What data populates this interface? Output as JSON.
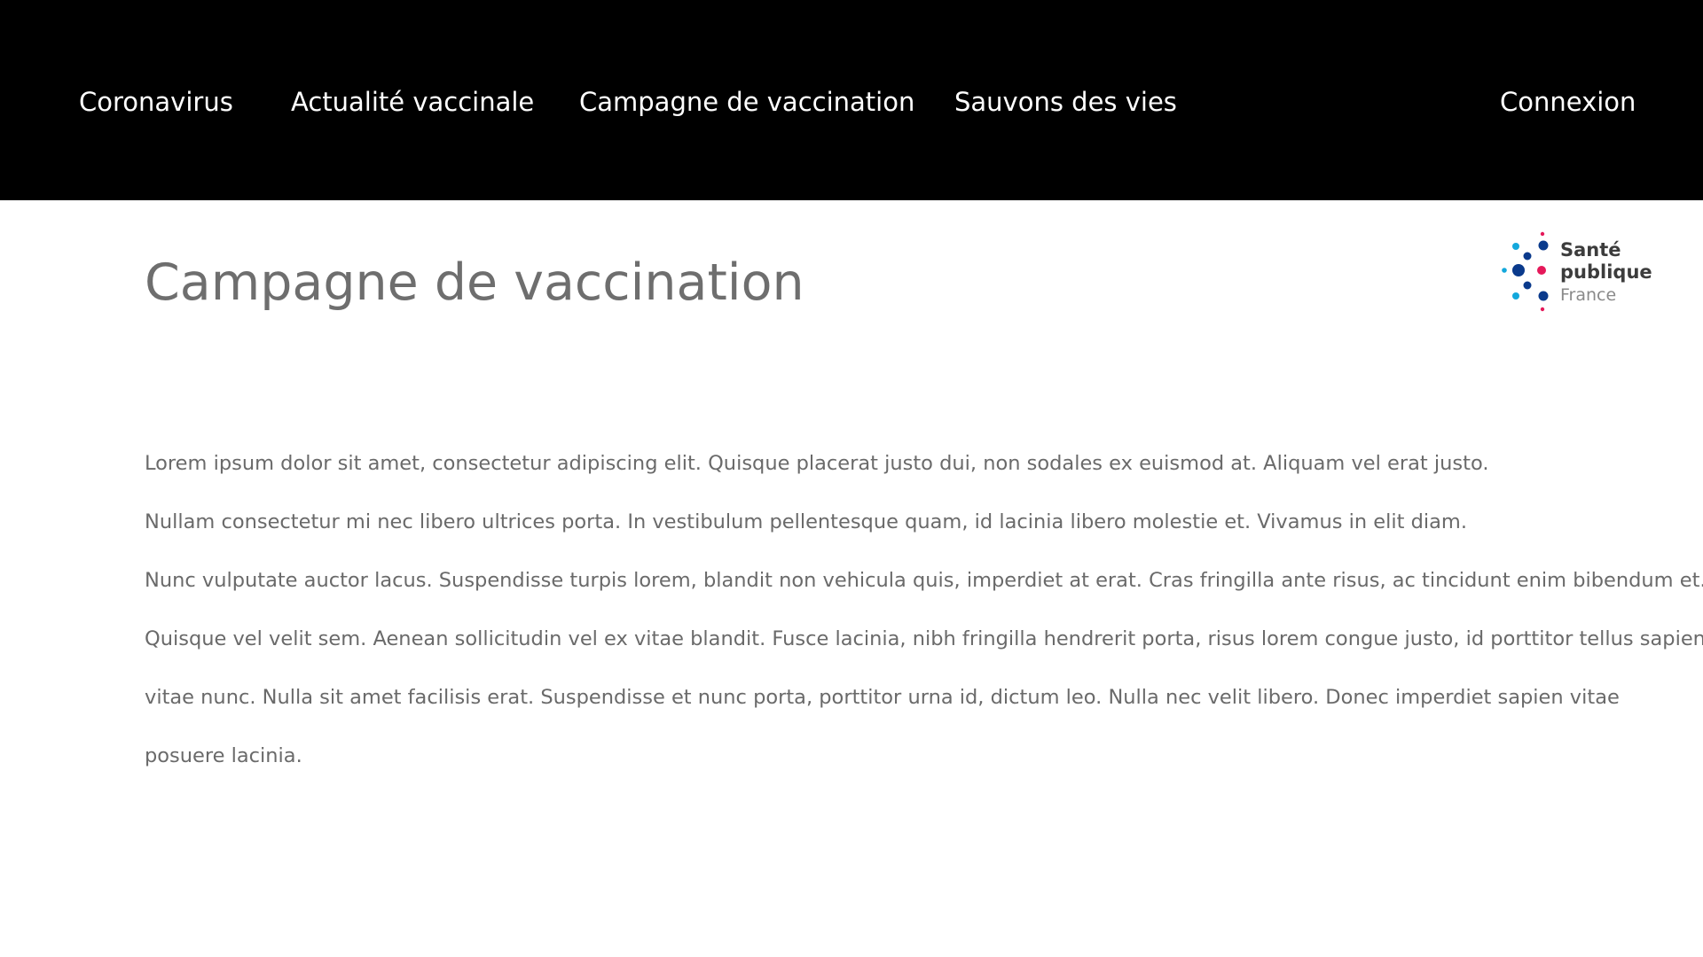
{
  "nav": {
    "items": [
      {
        "label": "Coronavirus"
      },
      {
        "label": "Actualité vaccinale"
      },
      {
        "label": "Campagne de vaccination"
      },
      {
        "label": "Sauvons des vies"
      }
    ],
    "login_label": "Connexion"
  },
  "page": {
    "title": "Campagne de vaccination"
  },
  "logo": {
    "line1": "Santé",
    "line2": "publique",
    "line3": "France",
    "colors": {
      "navy": "#0a3a8c",
      "cyan": "#13a8dc",
      "pink": "#e5195a"
    }
  },
  "content": {
    "lines": [
      "Lorem ipsum dolor sit amet, consectetur adipiscing elit. Quisque placerat justo dui, non sodales ex euismod at. Aliquam vel erat justo.",
      "Nullam consectetur mi nec libero ultrices porta. In vestibulum pellentesque quam, id lacinia libero molestie et. Vivamus in elit diam.",
      "Nunc vulputate auctor lacus. Suspendisse turpis lorem, blandit non vehicula quis, imperdiet at erat. Cras fringilla ante risus, ac tincidunt enim bibendum et.",
      "Quisque vel velit sem. Aenean sollicitudin vel ex vitae blandit. Fusce lacinia, nibh fringilla hendrerit porta, risus lorem congue justo, id porttitor tellus sapien",
      "vitae nunc. Nulla sit amet facilisis erat. Suspendisse et nunc porta, porttitor urna id, dictum leo. Nulla nec velit libero. Donec imperdiet sapien vitae",
      "posuere lacinia."
    ]
  },
  "theme": {
    "nav_background": "#000000",
    "nav_text": "#ffffff",
    "title_color": "#6e6e6e",
    "body_text_color": "#6a6a6a"
  }
}
